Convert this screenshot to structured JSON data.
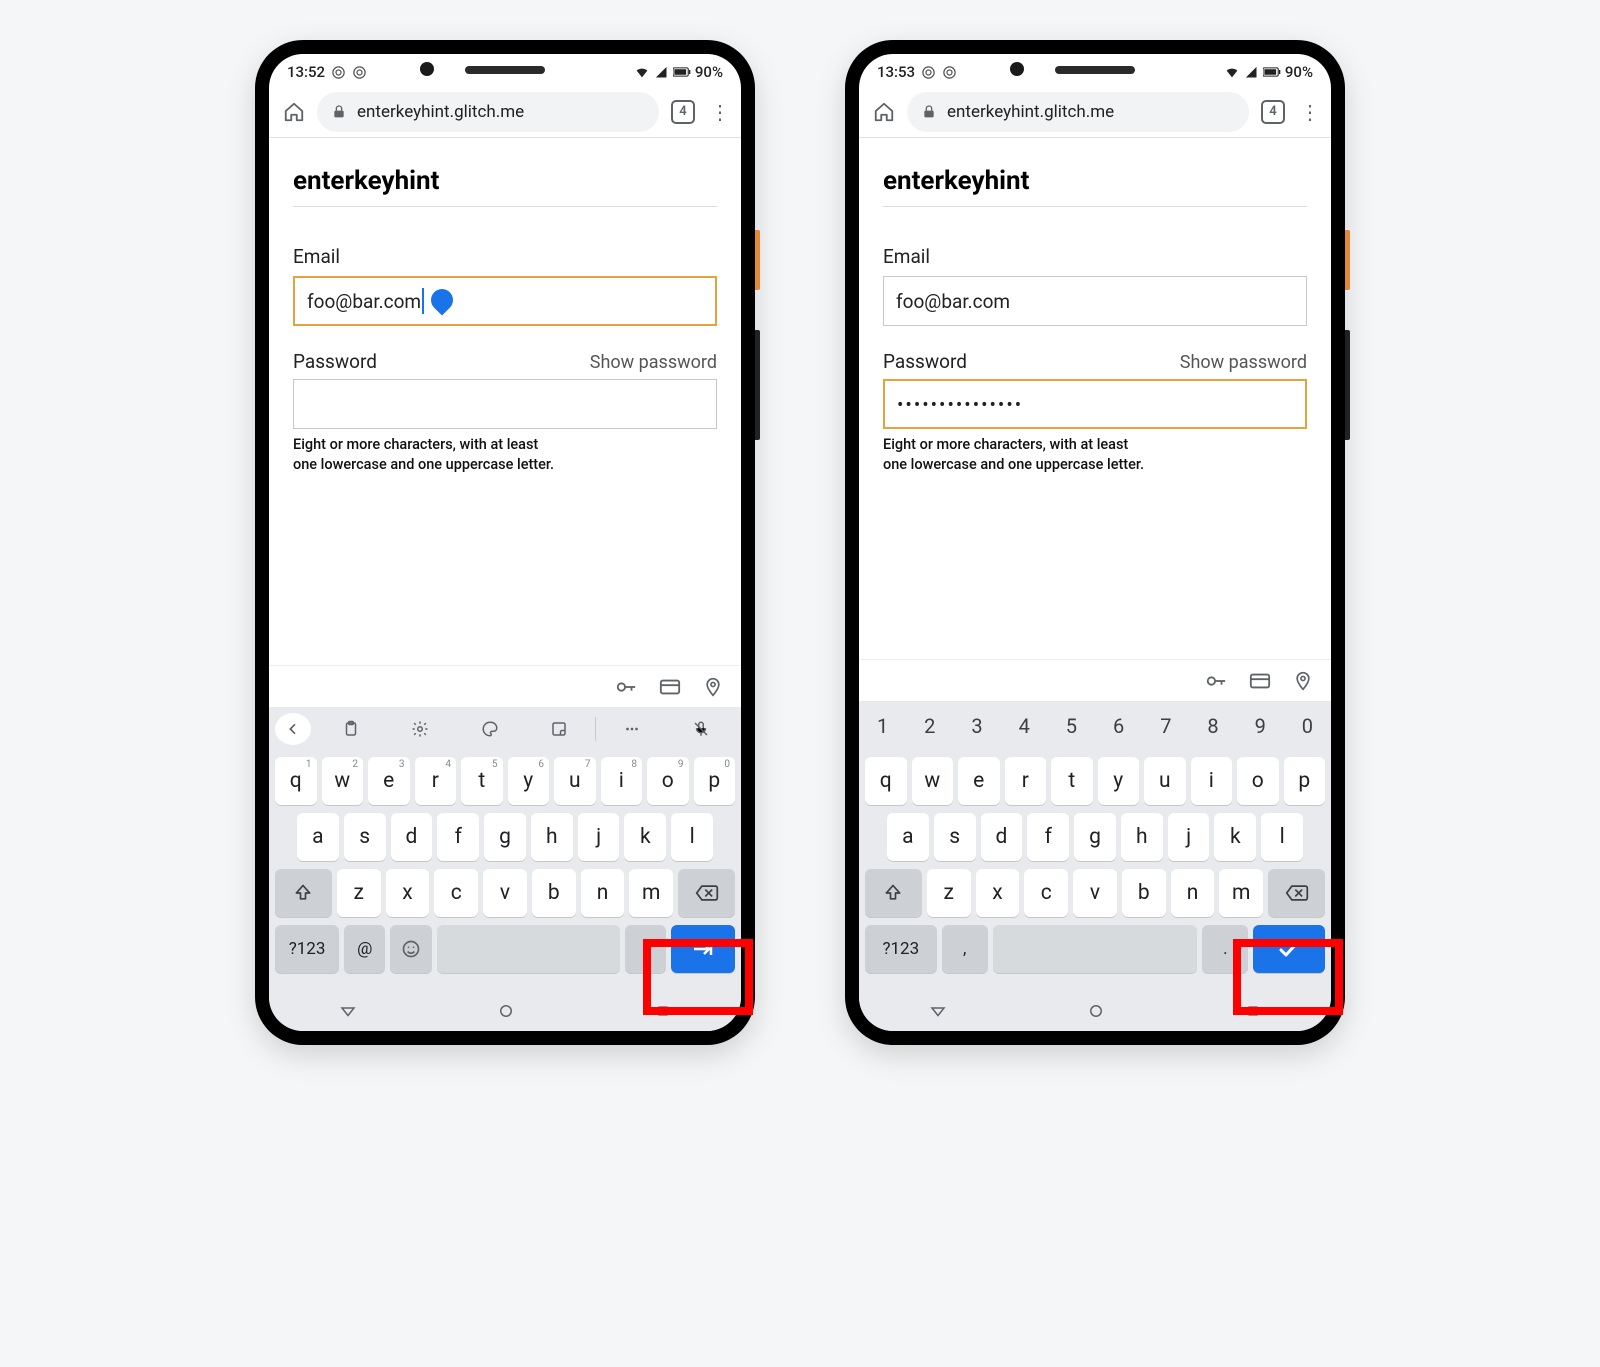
{
  "phones": [
    {
      "status": {
        "time": "13:52",
        "battery": "90%"
      },
      "browser": {
        "url": "enterkeyhint.glitch.me",
        "tab_count": "4"
      },
      "page": {
        "title": "enterkeyhint",
        "email_label": "Email",
        "email_value": "foo@bar.com",
        "email_focused": true,
        "password_label": "Password",
        "show_password": "Show password",
        "password_value": "",
        "password_focused": false,
        "hint": "Eight or more characters, with at least\none lowercase and one uppercase letter."
      },
      "keyboard": {
        "show_toolbar": true,
        "show_numrow": false,
        "row1": [
          {
            "k": "q",
            "s": "1"
          },
          {
            "k": "w",
            "s": "2"
          },
          {
            "k": "e",
            "s": "3"
          },
          {
            "k": "r",
            "s": "4"
          },
          {
            "k": "t",
            "s": "5"
          },
          {
            "k": "y",
            "s": "6"
          },
          {
            "k": "u",
            "s": "7"
          },
          {
            "k": "i",
            "s": "8"
          },
          {
            "k": "o",
            "s": "9"
          },
          {
            "k": "p",
            "s": "0"
          }
        ],
        "row2": [
          "a",
          "s",
          "d",
          "f",
          "g",
          "h",
          "j",
          "k",
          "l"
        ],
        "row3": [
          "z",
          "x",
          "c",
          "v",
          "b",
          "n",
          "m"
        ],
        "bottom": {
          "sym": "?123",
          "left2": "@",
          "period": ".",
          "enter_icon": "next"
        }
      }
    },
    {
      "status": {
        "time": "13:53",
        "battery": "90%"
      },
      "browser": {
        "url": "enterkeyhint.glitch.me",
        "tab_count": "4"
      },
      "page": {
        "title": "enterkeyhint",
        "email_label": "Email",
        "email_value": "foo@bar.com",
        "email_focused": false,
        "password_label": "Password",
        "show_password": "Show password",
        "password_value": "•••••••••••••••",
        "password_focused": true,
        "hint": "Eight or more characters, with at least\none lowercase and one uppercase letter."
      },
      "keyboard": {
        "show_toolbar": false,
        "show_numrow": true,
        "numrow": [
          "1",
          "2",
          "3",
          "4",
          "5",
          "6",
          "7",
          "8",
          "9",
          "0"
        ],
        "row1": [
          {
            "k": "q"
          },
          {
            "k": "w"
          },
          {
            "k": "e"
          },
          {
            "k": "r"
          },
          {
            "k": "t"
          },
          {
            "k": "y"
          },
          {
            "k": "u"
          },
          {
            "k": "i"
          },
          {
            "k": "o"
          },
          {
            "k": "p"
          }
        ],
        "row2": [
          "a",
          "s",
          "d",
          "f",
          "g",
          "h",
          "j",
          "k",
          "l"
        ],
        "row3": [
          "z",
          "x",
          "c",
          "v",
          "b",
          "n",
          "m"
        ],
        "bottom": {
          "sym": "?123",
          "left2": ",",
          "period": ".",
          "enter_icon": "done"
        }
      }
    }
  ]
}
